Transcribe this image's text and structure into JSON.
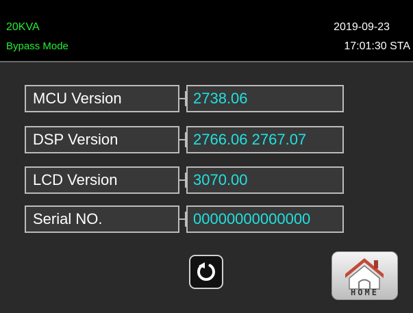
{
  "header": {
    "model": "20KVA",
    "mode": "Bypass Mode",
    "date": "2019-09-23",
    "time_status": "17:01:30 STA"
  },
  "rows": [
    {
      "label": "MCU Version",
      "value": "2738.06"
    },
    {
      "label": "DSP Version",
      "value": "2766.06 2767.07"
    },
    {
      "label": "LCD Version",
      "value": "3070.00"
    },
    {
      "label": "Serial NO.",
      "value": "00000000000000"
    }
  ],
  "buttons": {
    "refresh_icon": "refresh-icon",
    "home_icon": "house-icon",
    "home_label": "HOME"
  },
  "colors": {
    "header_bg": "#000000",
    "panel_bg": "#2a2a2a",
    "header_text": "#22ee33",
    "value_text": "#22e0e0",
    "label_text": "#ffffff"
  }
}
